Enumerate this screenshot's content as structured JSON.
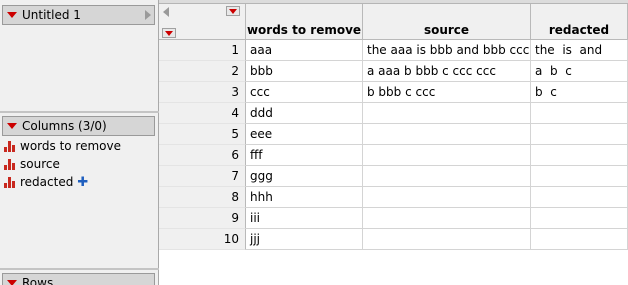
{
  "table_panel": {
    "title": "Untitled 1"
  },
  "columns_panel": {
    "title": "Columns (3/0)",
    "items": [
      {
        "label": "words to remove",
        "icon": "continuous-bar-icon"
      },
      {
        "label": "source",
        "icon": "continuous-bar-icon"
      },
      {
        "label": "redacted",
        "icon": "continuous-bar-icon",
        "extra_icon": "formula-cross-icon"
      }
    ]
  },
  "rows_panel": {
    "title": "Rows"
  },
  "grid": {
    "headers": [
      "words to remove",
      "source",
      "redacted"
    ],
    "rows": [
      {
        "n": "1",
        "cells": [
          "aaa",
          "the aaa is bbb and bbb ccc",
          "the  is  and"
        ]
      },
      {
        "n": "2",
        "cells": [
          "bbb",
          "a aaa b bbb c ccc ccc",
          "a  b  c"
        ]
      },
      {
        "n": "3",
        "cells": [
          "ccc",
          "b bbb c ccc",
          "b  c"
        ]
      },
      {
        "n": "4",
        "cells": [
          "ddd",
          "",
          ""
        ]
      },
      {
        "n": "5",
        "cells": [
          "eee",
          "",
          ""
        ]
      },
      {
        "n": "6",
        "cells": [
          "fff",
          "",
          ""
        ]
      },
      {
        "n": "7",
        "cells": [
          "ggg",
          "",
          ""
        ]
      },
      {
        "n": "8",
        "cells": [
          "hhh",
          "",
          ""
        ]
      },
      {
        "n": "9",
        "cells": [
          "iii",
          "",
          ""
        ]
      },
      {
        "n": "10",
        "cells": [
          "jjj",
          "",
          ""
        ]
      }
    ]
  },
  "colors": {
    "accent_red": "#cc0000",
    "panel_bg": "#f0f0f0",
    "header_bg": "#d6d6d6"
  }
}
